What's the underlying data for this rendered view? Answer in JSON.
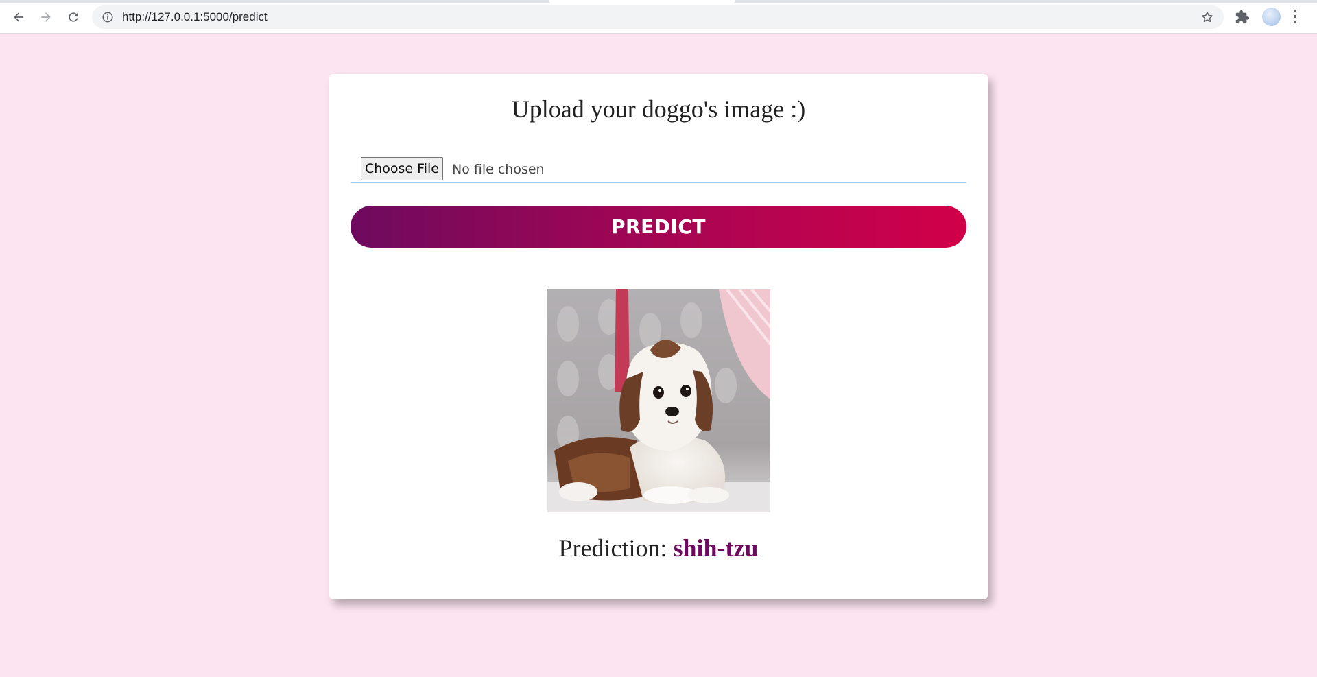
{
  "browser": {
    "url": "http://127.0.0.1:5000/predict",
    "icons": [
      "back-arrow-icon",
      "forward-arrow-icon",
      "reload-icon",
      "info-icon",
      "star-icon",
      "puzzle-icon",
      "kebab-menu-icon"
    ]
  },
  "form": {
    "title": "Upload your doggo's image :)",
    "choose_file_label": "Choose File",
    "file_status": "No file chosen",
    "predict_label": "PREDICT"
  },
  "result": {
    "prefix": "Prediction:",
    "breed": "shih-tzu"
  },
  "colors": {
    "page_background": "#fce4f1",
    "gradient_start": "#6e0a5e",
    "gradient_end": "#d10048",
    "prediction_value": "#6e0a5e"
  }
}
